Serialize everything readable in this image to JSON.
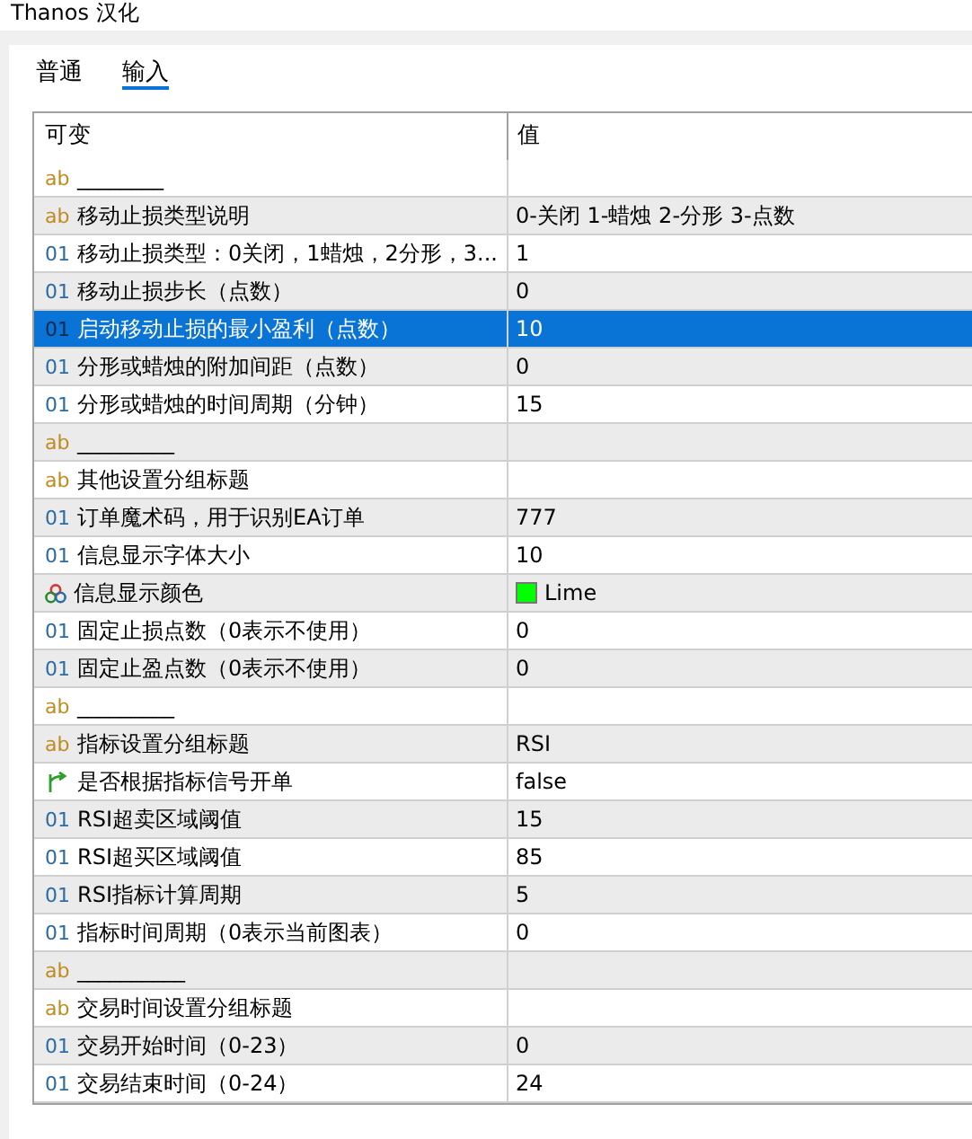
{
  "window": {
    "title": "Thanos 汉化"
  },
  "tabs": [
    {
      "label": "普通",
      "selected": false
    },
    {
      "label": "输入",
      "selected": true
    }
  ],
  "table": {
    "columns": [
      "可变",
      "值"
    ],
    "rows": [
      {
        "kind": "string",
        "icon": "ab",
        "name": "________",
        "value": "",
        "selected": false
      },
      {
        "kind": "string",
        "icon": "ab",
        "name": "移动止损类型说明",
        "value": "0-关闭  1-蜡烛  2-分形  3-点数",
        "selected": false
      },
      {
        "kind": "int",
        "icon": "01",
        "name": "移动止损类型：0关闭，1蜡烛，2分形，3...",
        "value": "1",
        "selected": false
      },
      {
        "kind": "int",
        "icon": "01",
        "name": "移动止损步长（点数）",
        "value": "0",
        "selected": false
      },
      {
        "kind": "int",
        "icon": "01",
        "name": "启动移动止损的最小盈利（点数）",
        "value": "10",
        "selected": true
      },
      {
        "kind": "int",
        "icon": "01",
        "name": "分形或蜡烛的附加间距（点数）",
        "value": "0",
        "selected": false
      },
      {
        "kind": "int",
        "icon": "01",
        "name": "分形或蜡烛的时间周期（分钟）",
        "value": "15",
        "selected": false
      },
      {
        "kind": "string",
        "icon": "ab",
        "name": "_________",
        "value": "",
        "selected": false
      },
      {
        "kind": "string",
        "icon": "ab",
        "name": "其他设置分组标题",
        "value": "",
        "selected": false
      },
      {
        "kind": "int",
        "icon": "01",
        "name": "订单魔术码，用于识别EA订单",
        "value": "777",
        "selected": false
      },
      {
        "kind": "int",
        "icon": "01",
        "name": "信息显示字体大小",
        "value": "10",
        "selected": false
      },
      {
        "kind": "color",
        "name": "信息显示颜色",
        "value": "Lime",
        "color": "#00ff00",
        "selected": false
      },
      {
        "kind": "int",
        "icon": "01",
        "name": "固定止损点数（0表示不使用）",
        "value": "0",
        "selected": false
      },
      {
        "kind": "int",
        "icon": "01",
        "name": "固定止盈点数（0表示不使用）",
        "value": "0",
        "selected": false
      },
      {
        "kind": "string",
        "icon": "ab",
        "name": "_________",
        "value": "",
        "selected": false
      },
      {
        "kind": "string",
        "icon": "ab",
        "name": "指标设置分组标题",
        "value": "RSI",
        "selected": false
      },
      {
        "kind": "bool",
        "name": "是否根据指标信号开单",
        "value": "false",
        "selected": false
      },
      {
        "kind": "int",
        "icon": "01",
        "name": "RSI超卖区域阈值",
        "value": "15",
        "selected": false
      },
      {
        "kind": "int",
        "icon": "01",
        "name": "RSI超买区域阈值",
        "value": "85",
        "selected": false
      },
      {
        "kind": "int",
        "icon": "01",
        "name": "RSI指标计算周期",
        "value": "5",
        "selected": false
      },
      {
        "kind": "int",
        "icon": "01",
        "name": "指标时间周期（0表示当前图表）",
        "value": "0",
        "selected": false
      },
      {
        "kind": "string",
        "icon": "ab",
        "name": "__________",
        "value": "",
        "selected": false
      },
      {
        "kind": "string",
        "icon": "ab",
        "name": "交易时间设置分组标题",
        "value": "",
        "selected": false
      },
      {
        "kind": "int",
        "icon": "01",
        "name": "交易开始时间（0-23）",
        "value": "0",
        "selected": false
      },
      {
        "kind": "int",
        "icon": "01",
        "name": "交易结束时间（0-24）",
        "value": "24",
        "selected": false
      }
    ]
  }
}
